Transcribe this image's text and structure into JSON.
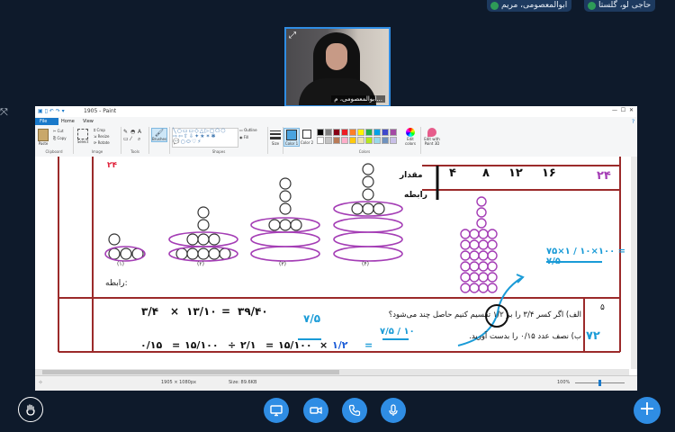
{
  "participants": [
    {
      "name": "حاجی لو، گلستا"
    },
    {
      "name": "ابوالمعصومی، مریم"
    }
  ],
  "video": {
    "name": "ابوالمعصومی، م..."
  },
  "paint": {
    "title": "1905 - Paint",
    "tabs": [
      "File",
      "Home",
      "View"
    ],
    "groups": {
      "clipboard": "Clipboard",
      "image": "Image",
      "tools": "Tools",
      "shapes": "Shapes",
      "colors": "Colors"
    },
    "buttons": {
      "paste": "Paste",
      "cut": "Cut",
      "copy": "Copy",
      "select": "Select",
      "crop": "Crop",
      "resize": "Resize",
      "rotate": "Rotate",
      "brushes": "Brushes",
      "outline": "Outline",
      "fill": "Fill",
      "size": "Size",
      "color1": "Color 1",
      "color2": "Color 2",
      "edit_colors": "Edit colors",
      "edit_paint3d": "Edit with Paint 3D"
    },
    "palette": [
      "#000000",
      "#7f7f7f",
      "#880015",
      "#ed1c24",
      "#ff7f27",
      "#fff200",
      "#22b14c",
      "#00a2e8",
      "#3f48cc",
      "#a349a4",
      "#ffffff",
      "#c3c3c3",
      "#b97a57",
      "#ffaec9",
      "#ffc90e",
      "#efe4b0",
      "#b5e61d",
      "#99d9ea",
      "#7092be",
      "#c8bfe7"
    ],
    "status": {
      "size": "1905 × 1080px",
      "file_size": "Size: 89.6KB",
      "zoom": "100%"
    }
  },
  "worksheet": {
    "label_rabete": "رابطه:",
    "counts": [
      "(۱)",
      "(۲)",
      "(۳)",
      "(۴)"
    ],
    "table_row": [
      "۴",
      "۸",
      "۱۲",
      "۱۶",
      "۲۴"
    ],
    "table_labels": [
      "مقدار",
      "رابطه"
    ],
    "row_number": "۵",
    "question_a": "الف) اگر کسر  ۳/۴  را بر ۱/۲ تقسیم کنیم حاصل چند می‌شود؟",
    "question_b": "ب) نصف عدد ۰/۱۵ را بدست آورید.",
    "handwritten": {
      "red_mark": "۲۴",
      "eq1_left": "۳/۴",
      "eq1_mid": "۱۳/۱۰",
      "eq1_right": "۳۹/۴۰",
      "eq2_a": "۰/۱۵",
      "eq2_b": "۱۵/۱۰۰",
      "eq2_c": "۲/۱",
      "eq2_d": "۱۵/۱۰۰",
      "eq2_e": "۱/۲",
      "blue_75": "۷/۵",
      "blue_frac": "۷/۵ / ۱۰",
      "blue_side": "۷۵×۱ / ۱۰×۱۰۰ = ۷/۵",
      "blue_right": "۷۲"
    }
  },
  "controls": {
    "hand": "raise-hand",
    "screen": "share-screen",
    "camera": "camera",
    "phone": "phone",
    "mic": "microphone",
    "more": "+"
  }
}
